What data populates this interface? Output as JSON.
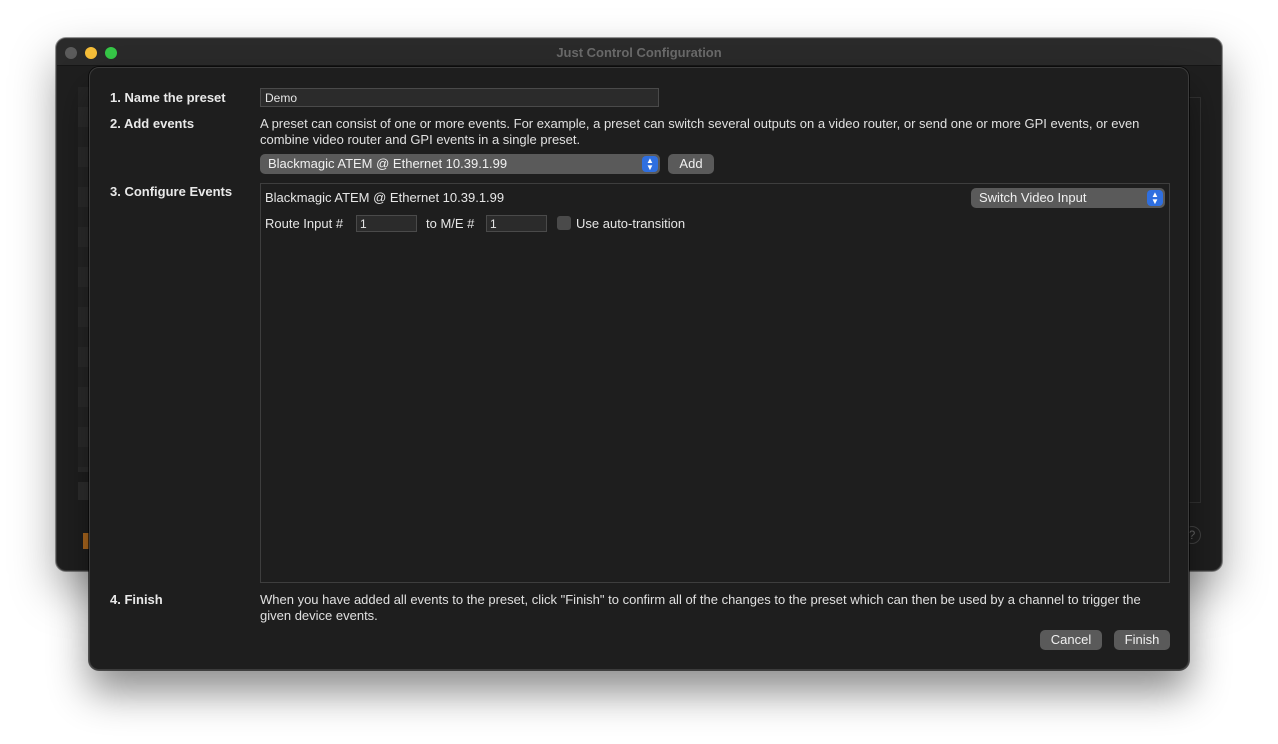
{
  "window": {
    "title": "Just Control Configuration"
  },
  "background": {
    "help_icon": "?"
  },
  "steps": {
    "step1_label": "1. Name the preset",
    "step2_label": "2. Add events",
    "step3_label": "3. Configure Events",
    "step4_label": "4. Finish"
  },
  "preset_name": {
    "value": "Demo"
  },
  "add_events": {
    "description": "A preset can consist of one or more events. For example, a preset can switch several outputs on a video router, or send one or more GPI events, or even combine video router and GPI events in a single preset.",
    "device_selected": "Blackmagic ATEM @ Ethernet 10.39.1.99",
    "add_label": "Add"
  },
  "event": {
    "device_label": "Blackmagic ATEM @ Ethernet 10.39.1.99",
    "action_selected": "Switch Video Input",
    "route_input_label": "Route Input #",
    "route_input_value": "1",
    "to_me_label": "to M/E #",
    "to_me_value": "1",
    "auto_transition_label": "Use auto-transition",
    "auto_transition_checked": false
  },
  "finish": {
    "description": "When you have added all events to the preset, click \"Finish\" to confirm all of the changes to the preset which can then be used by a channel to trigger the given device events.",
    "cancel_label": "Cancel",
    "finish_label": "Finish"
  },
  "icons": {
    "popup_chevron": "up-down-chevron-icon"
  },
  "colors": {
    "accent": "#2f6fe0",
    "sheet_bg": "#1e1e1e",
    "button_bg": "#5a5a5a"
  }
}
